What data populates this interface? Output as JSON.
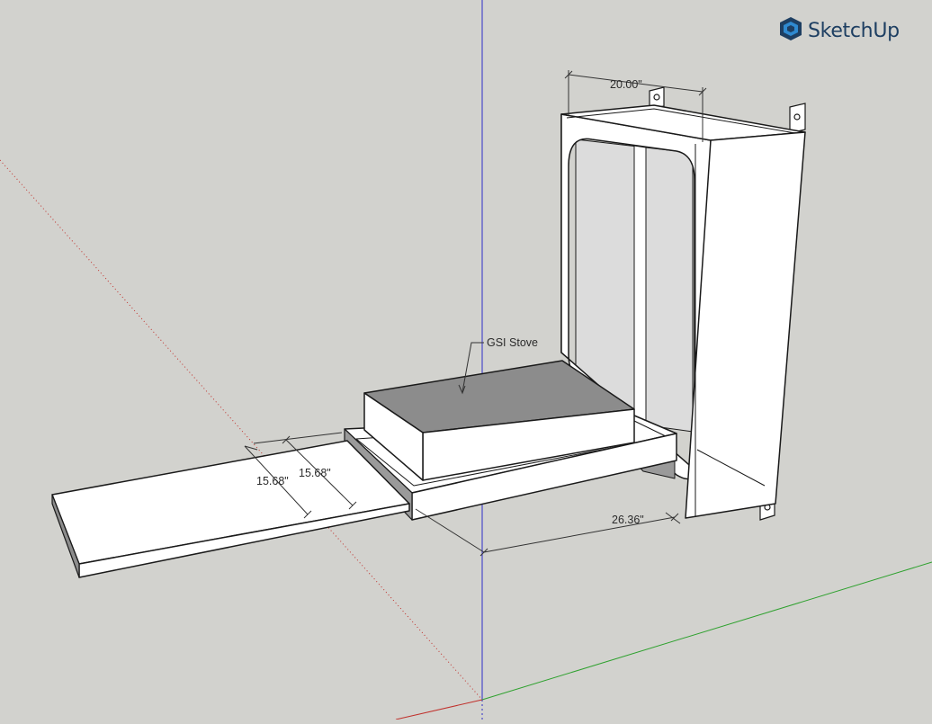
{
  "app": {
    "name": "SketchUp",
    "logo_icon": "sketchup-logo-icon"
  },
  "colors": {
    "background": "#d2d2ce",
    "face": "#ffffff",
    "shaded_face": "#8c8c8c",
    "edge": "#1a1a1a",
    "axis_red": "#c0302b",
    "axis_green": "#2ea12e",
    "axis_blue": "#2d2dc8",
    "brand": "#1e3f62"
  },
  "dimensions": {
    "box_width": "20.00\"",
    "shelf_a": "15.68\"",
    "shelf_b": "15.68\"",
    "depth": "26.36\""
  },
  "labels": {
    "stove": "GSI Stove"
  }
}
